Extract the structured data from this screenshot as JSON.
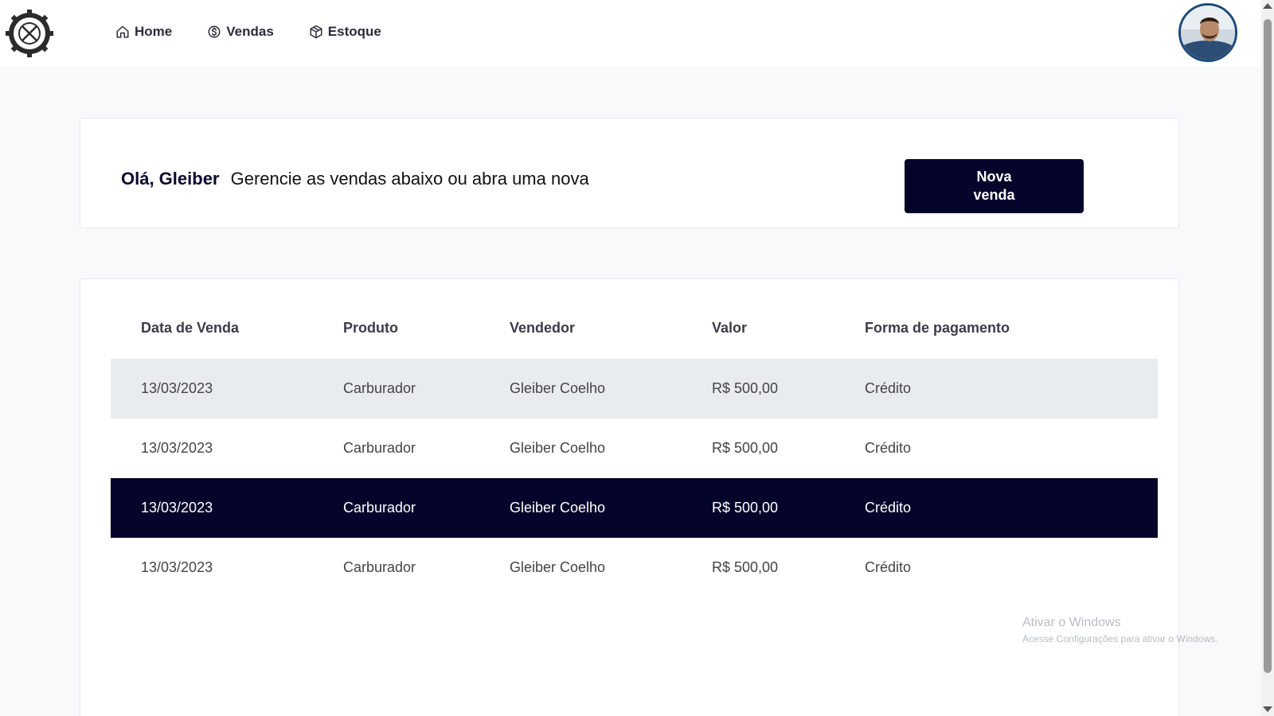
{
  "nav": {
    "home": "Home",
    "sales": "Vendas",
    "stock": "Estoque"
  },
  "greeting": {
    "name": "Olá, Gleiber",
    "message": "Gerencie as vendas abaixo ou abra uma nova"
  },
  "actions": {
    "new_sale_line1": "Nova",
    "new_sale_line2": "venda"
  },
  "table": {
    "headers": [
      "Data de Venda",
      "Produto",
      "Vendedor",
      "Valor",
      "Forma de pagamento"
    ],
    "rows": [
      {
        "date": "13/03/2023",
        "product": "Carburador",
        "seller": "Gleiber Coelho",
        "value": "R$ 500,00",
        "payment": "Crédito"
      },
      {
        "date": "13/03/2023",
        "product": "Carburador",
        "seller": "Gleiber Coelho",
        "value": "R$ 500,00",
        "payment": "Crédito"
      },
      {
        "date": "13/03/2023",
        "product": "Carburador",
        "seller": "Gleiber Coelho",
        "value": "R$ 500,00",
        "payment": "Crédito"
      },
      {
        "date": "13/03/2023",
        "product": "Carburador",
        "seller": "Gleiber Coelho",
        "value": "R$ 500,00",
        "payment": "Crédito"
      }
    ]
  },
  "watermark": {
    "line1": "Ativar o Windows",
    "line2": "Acesse Configurações para ativar o Windows."
  },
  "colors": {
    "primary": "#05042a",
    "row_alt": "#e9ecef",
    "background": "#f8f9fb"
  }
}
